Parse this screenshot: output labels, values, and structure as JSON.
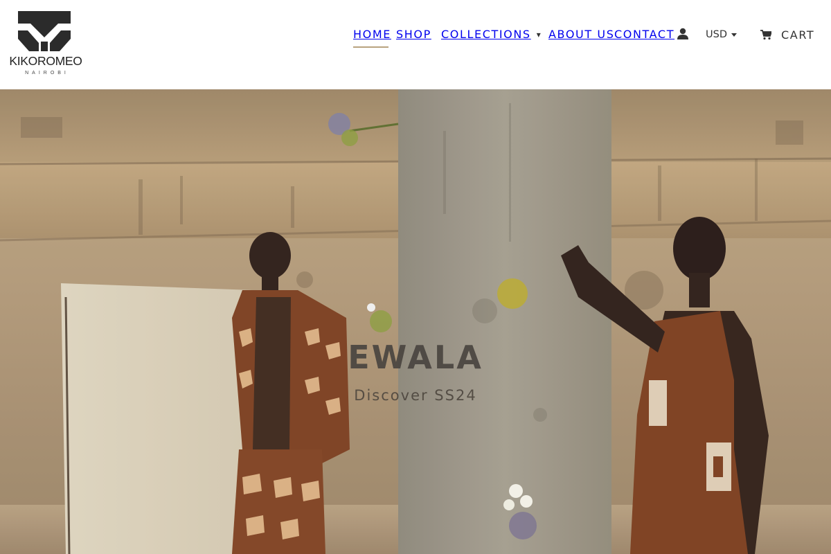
{
  "brand": {
    "name": "KIKOROMEO",
    "city": "NAIROBI"
  },
  "nav": {
    "home": "HOME",
    "shop": "SHOP",
    "collections": "COLLECTIONS",
    "collections_caret": "▾",
    "about": "ABOUT US",
    "contact": "CONTACT",
    "account_icon": "user-icon"
  },
  "currency": {
    "selected": "USD"
  },
  "cart": {
    "label": "CART",
    "icon": "cart-icon"
  },
  "hero": {
    "title": "EWALA",
    "subtitle": "Discover SS24"
  },
  "colors": {
    "accent_underline": "#b8a27e",
    "text": "#333333",
    "logo": "#222222"
  }
}
